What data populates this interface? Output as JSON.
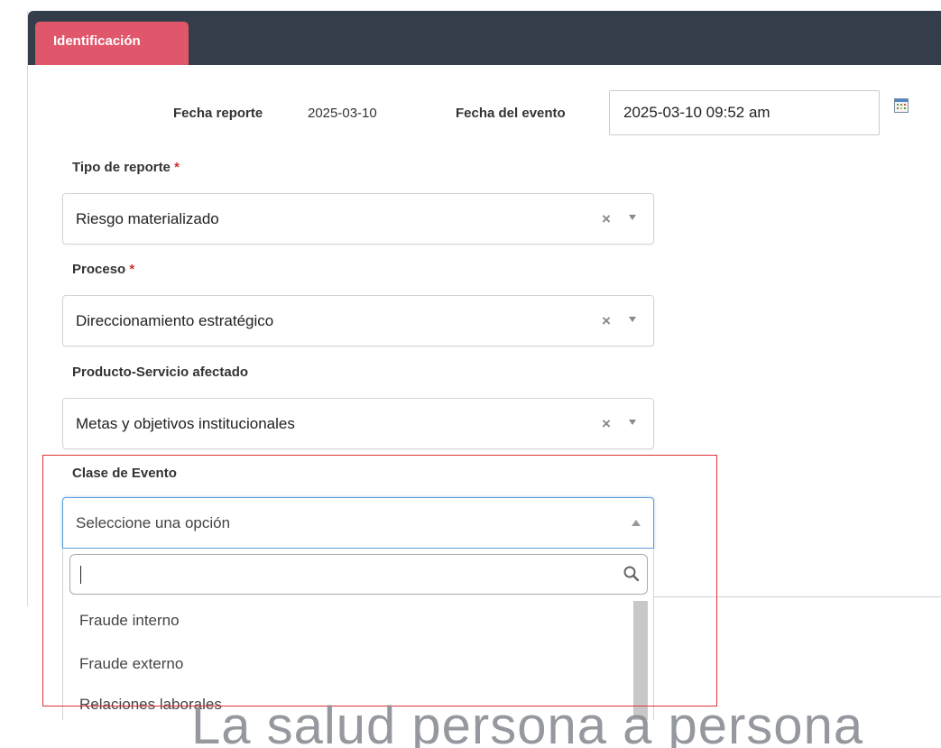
{
  "tabs": {
    "active_label": "Identificación"
  },
  "dates": {
    "report_label": "Fecha reporte",
    "report_value": "2025-03-10",
    "event_label": "Fecha del evento",
    "event_value": "2025-03-10 09:52 am",
    "calendar_icon": "calendar-icon"
  },
  "fields": {
    "tipo_reporte": {
      "label": "Tipo de reporte",
      "required_mark": "*",
      "value": "Riesgo materializado",
      "clear": "×"
    },
    "proceso": {
      "label": "Proceso",
      "required_mark": "*",
      "value": "Direccionamiento estratégico",
      "clear": "×"
    },
    "producto": {
      "label": "Producto-Servicio afectado",
      "value": "Metas y objetivos institucionales",
      "clear": "×"
    },
    "clase_evento": {
      "label": "Clase de Evento",
      "placeholder": "Seleccione una opción"
    }
  },
  "dropdown": {
    "search_value": "",
    "search_icon": "search-icon",
    "options": [
      "Fraude interno",
      "Fraude externo",
      "Relaciones laborales"
    ]
  },
  "watermark": {
    "text": "La salud persona a persona"
  },
  "colors": {
    "tab_active": "#e0566a",
    "tabbar": "#343e4b",
    "highlight": "#e0333b",
    "focus": "#5b9dd9"
  }
}
